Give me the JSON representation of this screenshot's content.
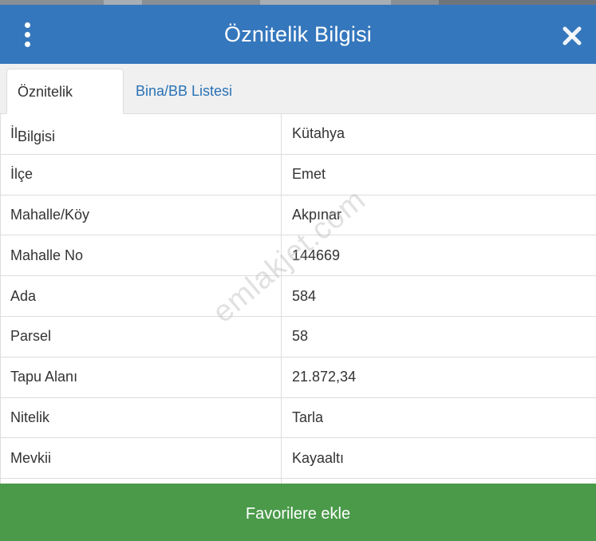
{
  "header": {
    "title": "Öznitelik Bilgisi",
    "menu_icon": "vertical-ellipsis-icon",
    "close_icon": "close-icon",
    "color": "#3577bd"
  },
  "tabs": [
    {
      "label": "Öznitelik Bilgisi",
      "active": true
    },
    {
      "label": "Bina/BB Listesi",
      "active": false
    }
  ],
  "attributes": [
    {
      "label": "İl",
      "value": "Kütahya"
    },
    {
      "label": "İlçe",
      "value": "Emet"
    },
    {
      "label": "Mahalle/Köy",
      "value": "Akpınar"
    },
    {
      "label": "Mahalle No",
      "value": "144669"
    },
    {
      "label": "Ada",
      "value": "584"
    },
    {
      "label": "Parsel",
      "value": "58"
    },
    {
      "label": "Tapu Alanı",
      "value": "21.872,34"
    },
    {
      "label": "Nitelik",
      "value": "Tarla"
    },
    {
      "label": "Mevkii",
      "value": "Kayaaltı"
    }
  ],
  "watermark": "emlakjet.com",
  "footer": {
    "button_label": "Favorilere ekle",
    "color": "#4a9a4a"
  }
}
